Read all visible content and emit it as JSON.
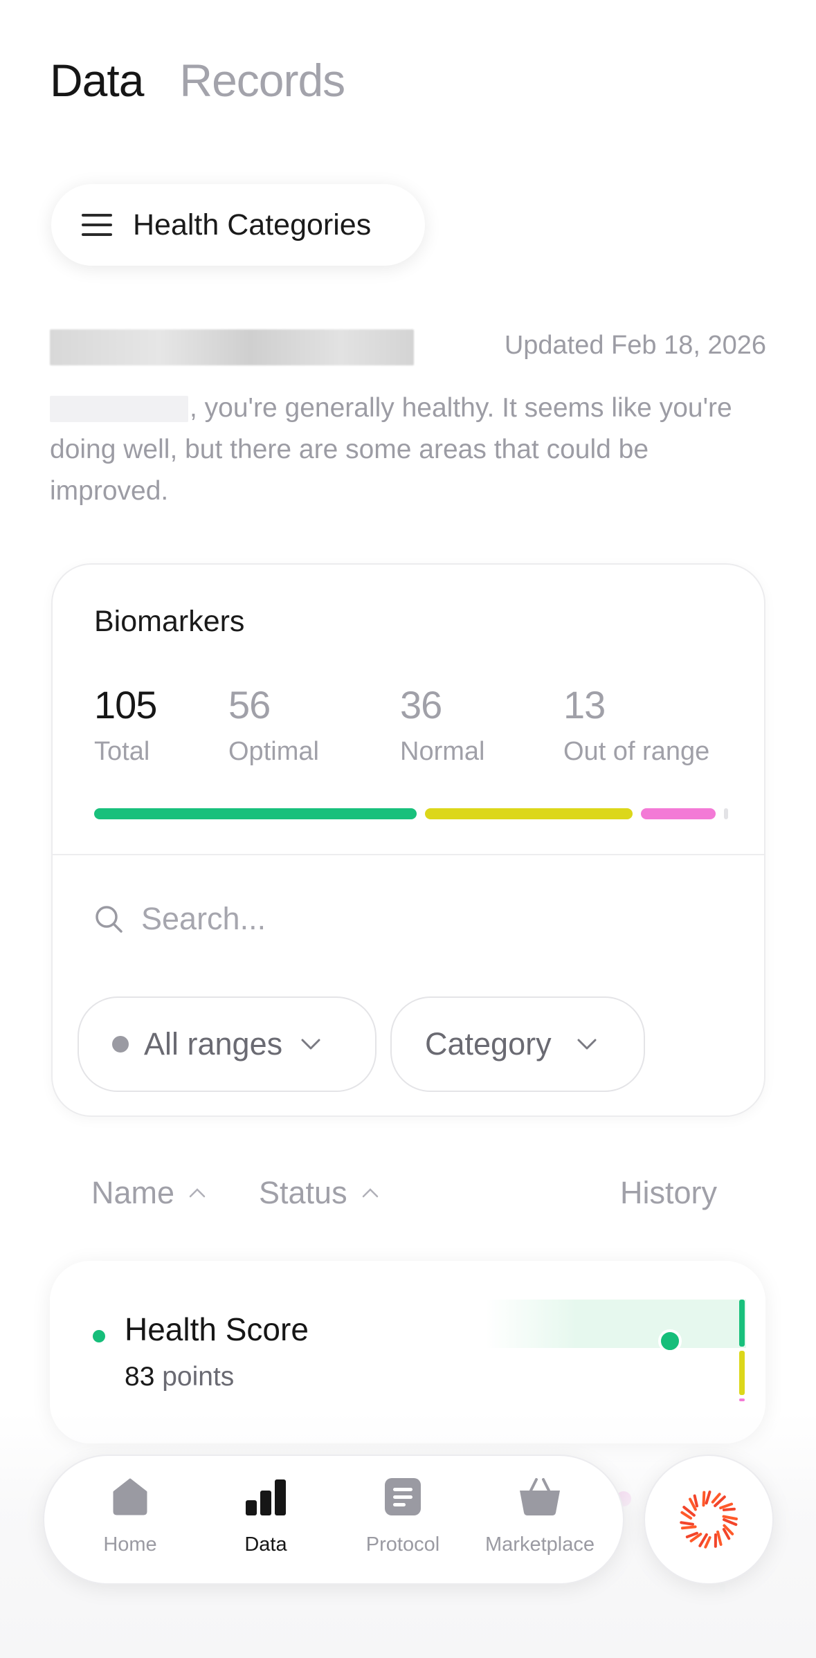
{
  "tabs": {
    "active": "Data",
    "inactive": "Records"
  },
  "category_button": {
    "label": "Health Categories",
    "icon": "menu-icon"
  },
  "header": {
    "updated": "Updated Feb 18, 2026",
    "summary": ", you're generally healthy. It seems like you're doing well, but there are some areas that could be improved."
  },
  "biomarkers": {
    "title": "Biomarkers",
    "stats": [
      {
        "value": "105",
        "label": "Total"
      },
      {
        "value": "56",
        "label": "Optimal"
      },
      {
        "value": "36",
        "label": "Normal"
      },
      {
        "value": "13",
        "label": "Out of range"
      }
    ],
    "colors": {
      "optimal": "#19c07c",
      "normal": "#dcd71a",
      "out_of_range": "#f37ad6",
      "unknown": "#e3e3e6"
    },
    "search_placeholder": "Search...",
    "filters": {
      "ranges": "All ranges",
      "category": "Category"
    }
  },
  "columns": {
    "name": "Name",
    "status": "Status",
    "history": "History"
  },
  "rows": [
    {
      "name": "Health Score",
      "value": "83",
      "unit": "points",
      "status_color": "#16be7a"
    }
  ],
  "nav": {
    "items": [
      {
        "label": "Home",
        "icon": "home-icon"
      },
      {
        "label": "Data",
        "icon": "bar-chart-icon"
      },
      {
        "label": "Protocol",
        "icon": "document-icon"
      },
      {
        "label": "Marketplace",
        "icon": "basket-icon"
      }
    ],
    "active": "Data",
    "ai_icon": "sunburst-icon"
  }
}
